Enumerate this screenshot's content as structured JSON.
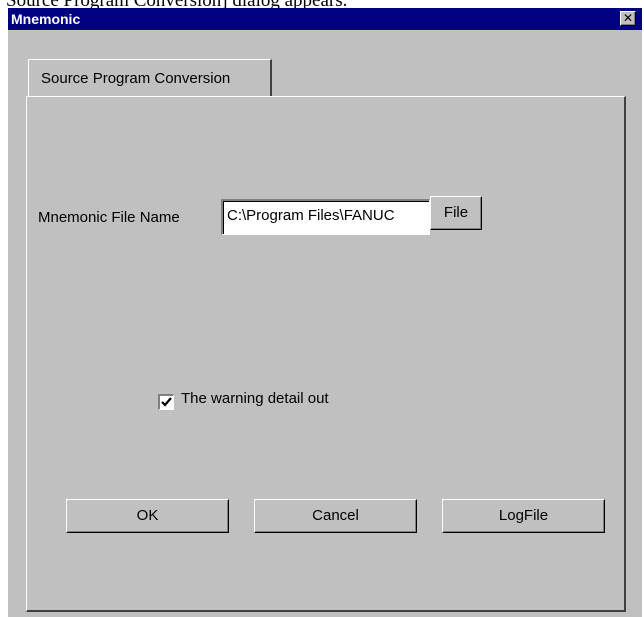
{
  "document": {
    "header_fragment": "Source Program Conversion] dialog appears."
  },
  "window": {
    "title": "Mnemonic",
    "close_glyph": "✕"
  },
  "tabs": [
    {
      "label": "Source Program Conversion",
      "selected": true
    }
  ],
  "form": {
    "file_label": "Mnemonic File Name",
    "file_value": "C:\\Program Files\\FANUC",
    "file_button_label": "File",
    "warning_checkbox_label": "The warning detail out",
    "warning_checked": true
  },
  "buttons": {
    "ok_label": "OK",
    "cancel_label": "Cancel",
    "logfile_label": "LogFile"
  },
  "colors": {
    "title_bar": "#000080",
    "face": "#c0c0c0"
  },
  "icons": {
    "close": "close-icon",
    "check": "checkmark-icon"
  }
}
